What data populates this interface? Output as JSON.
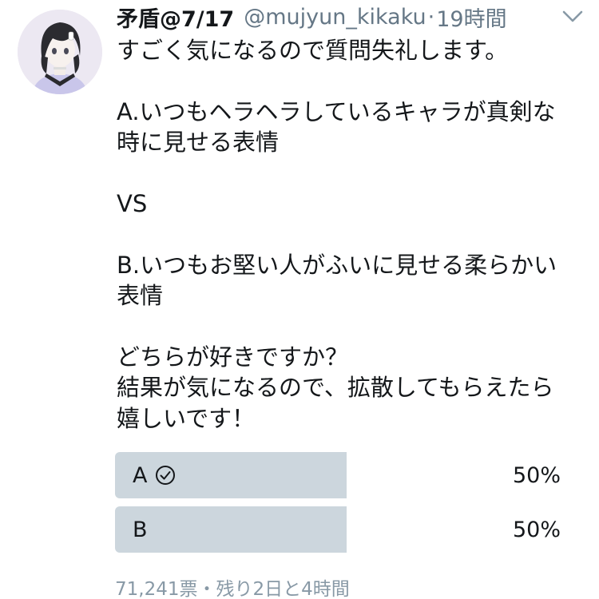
{
  "tweet": {
    "display_name": "矛盾@7/17",
    "handle": "@mujyun_kikaku",
    "separator": "·",
    "time": "19時間",
    "lines": [
      "すごく気になるので質問失礼します。",
      "",
      "A.いつもヘラヘラしているキャラが真剣な",
      "時に見せる表情",
      "",
      "VS",
      "",
      "B.いつもお堅い人がふいに見せる柔らかい",
      "表情",
      "",
      "どちらが好きですか？",
      "結果が気になるので、拡散してもらえたら",
      "嬉しいです！"
    ]
  },
  "poll": {
    "options": [
      {
        "label": "A",
        "percent_text": "50%",
        "fraction": 0.5,
        "voted": true
      },
      {
        "label": "B",
        "percent_text": "50%",
        "fraction": 0.5,
        "voted": false
      }
    ],
    "meta": "71,241票・残り2日と4時間"
  },
  "colors": {
    "poll_fill": "#ccd6dd",
    "secondary_text": "#657786",
    "meta_text": "#8899a6"
  },
  "icons": {
    "avatar": "avatar-image",
    "caret": "chevron-down-icon",
    "check": "check-circle-icon"
  }
}
